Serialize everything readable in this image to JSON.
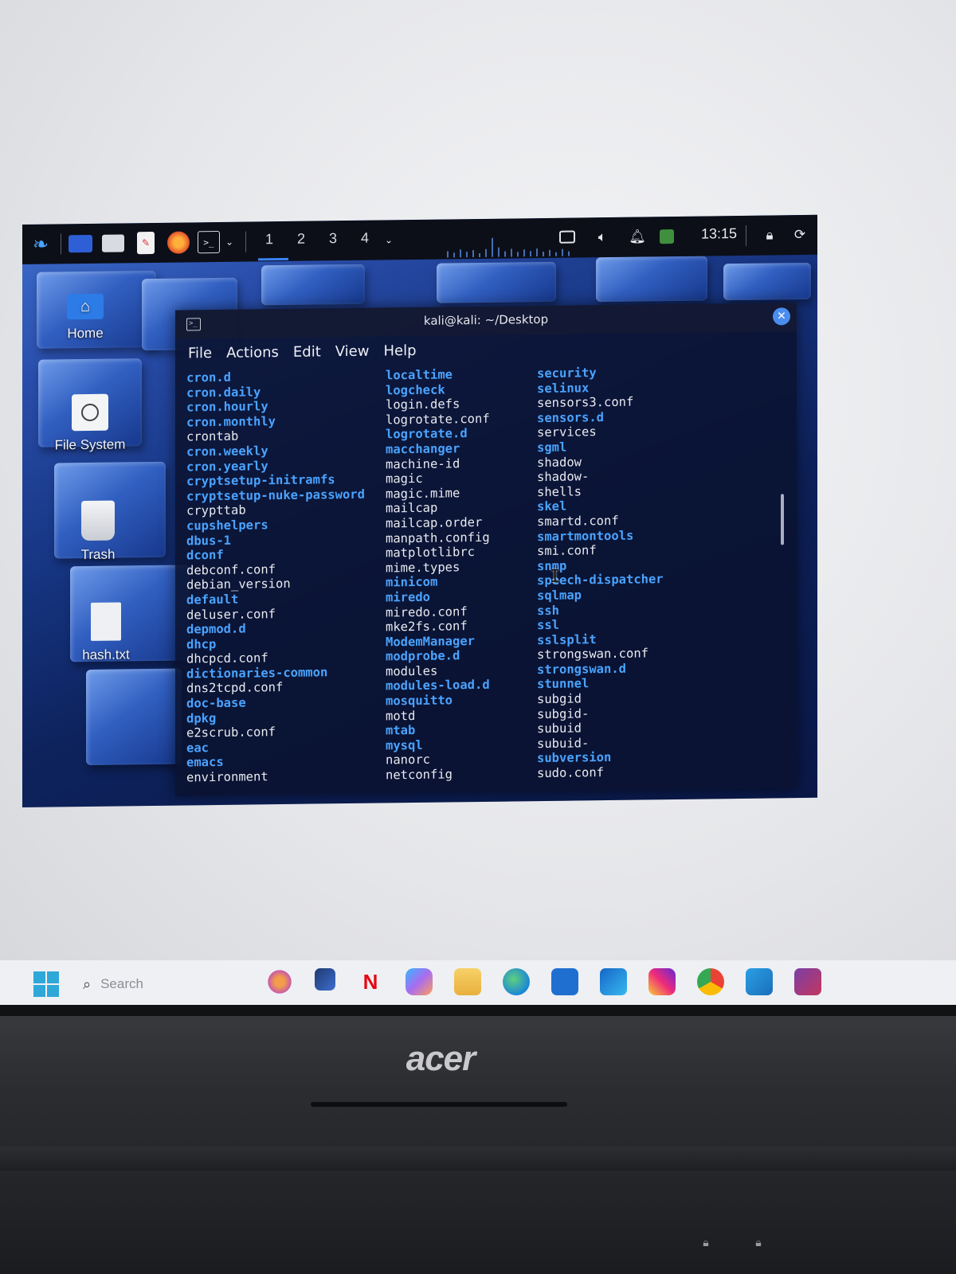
{
  "kali_panel": {
    "workspaces": [
      "1",
      "2",
      "3",
      "4"
    ],
    "clock": "13:15",
    "icons": [
      "kali-menu-icon",
      "desktop-icon",
      "file-manager-icon",
      "text-editor-icon",
      "firefox-icon",
      "terminal-icon",
      "chevron-down-icon",
      "display-icon",
      "volume-icon",
      "bell-icon",
      "battery-icon",
      "lock-icon",
      "power-icon"
    ]
  },
  "desktop_icons": [
    {
      "label": "Home",
      "icon": "home-icon"
    },
    {
      "label": "File System",
      "icon": "drive-icon"
    },
    {
      "label": "Trash",
      "icon": "trash-icon"
    },
    {
      "label": "hash.txt",
      "icon": "text-file-icon"
    }
  ],
  "terminal": {
    "title": "kali@kali: ~/Desktop",
    "menu": [
      "File",
      "Actions",
      "Edit",
      "View",
      "Help"
    ],
    "columns": [
      [
        {
          "name": "cron.d",
          "dir": true
        },
        {
          "name": "cron.daily",
          "dir": true
        },
        {
          "name": "cron.hourly",
          "dir": true
        },
        {
          "name": "cron.monthly",
          "dir": true
        },
        {
          "name": "crontab",
          "dir": false
        },
        {
          "name": "cron.weekly",
          "dir": true
        },
        {
          "name": "cron.yearly",
          "dir": true
        },
        {
          "name": "cryptsetup-initramfs",
          "dir": true
        },
        {
          "name": "cryptsetup-nuke-password",
          "dir": true
        },
        {
          "name": "crypttab",
          "dir": false
        },
        {
          "name": "cupshelpers",
          "dir": true
        },
        {
          "name": "dbus-1",
          "dir": true
        },
        {
          "name": "dconf",
          "dir": true
        },
        {
          "name": "debconf.conf",
          "dir": false
        },
        {
          "name": "debian_version",
          "dir": false
        },
        {
          "name": "default",
          "dir": true
        },
        {
          "name": "deluser.conf",
          "dir": false
        },
        {
          "name": "depmod.d",
          "dir": true
        },
        {
          "name": "dhcp",
          "dir": true
        },
        {
          "name": "dhcpcd.conf",
          "dir": false
        },
        {
          "name": "dictionaries-common",
          "dir": true
        },
        {
          "name": "dns2tcpd.conf",
          "dir": false
        },
        {
          "name": "doc-base",
          "dir": true
        },
        {
          "name": "dpkg",
          "dir": true
        },
        {
          "name": "e2scrub.conf",
          "dir": false
        },
        {
          "name": "eac",
          "dir": true
        },
        {
          "name": "emacs",
          "dir": true
        },
        {
          "name": "environment",
          "dir": false
        }
      ],
      [
        {
          "name": "localtime",
          "dir": true
        },
        {
          "name": "logcheck",
          "dir": true
        },
        {
          "name": "login.defs",
          "dir": false
        },
        {
          "name": "logrotate.conf",
          "dir": false
        },
        {
          "name": "logrotate.d",
          "dir": true
        },
        {
          "name": "macchanger",
          "dir": true
        },
        {
          "name": "machine-id",
          "dir": false
        },
        {
          "name": "magic",
          "dir": false
        },
        {
          "name": "magic.mime",
          "dir": false
        },
        {
          "name": "mailcap",
          "dir": false
        },
        {
          "name": "mailcap.order",
          "dir": false
        },
        {
          "name": "manpath.config",
          "dir": false
        },
        {
          "name": "matplotlibrc",
          "dir": false
        },
        {
          "name": "mime.types",
          "dir": false
        },
        {
          "name": "minicom",
          "dir": true
        },
        {
          "name": "miredo",
          "dir": true
        },
        {
          "name": "miredo.conf",
          "dir": false
        },
        {
          "name": "mke2fs.conf",
          "dir": false
        },
        {
          "name": "ModemManager",
          "dir": true
        },
        {
          "name": "modprobe.d",
          "dir": true
        },
        {
          "name": "modules",
          "dir": false
        },
        {
          "name": "modules-load.d",
          "dir": true
        },
        {
          "name": "mosquitto",
          "dir": true
        },
        {
          "name": "motd",
          "dir": false
        },
        {
          "name": "mtab",
          "dir": true
        },
        {
          "name": "mysql",
          "dir": true
        },
        {
          "name": "nanorc",
          "dir": false
        },
        {
          "name": "netconfig",
          "dir": false
        }
      ],
      [
        {
          "name": "security",
          "dir": true
        },
        {
          "name": "selinux",
          "dir": true
        },
        {
          "name": "sensors3.conf",
          "dir": false
        },
        {
          "name": "sensors.d",
          "dir": true
        },
        {
          "name": "services",
          "dir": false
        },
        {
          "name": "sgml",
          "dir": true
        },
        {
          "name": "shadow",
          "dir": false
        },
        {
          "name": "shadow-",
          "dir": false
        },
        {
          "name": "shells",
          "dir": false
        },
        {
          "name": "skel",
          "dir": true
        },
        {
          "name": "smartd.conf",
          "dir": false
        },
        {
          "name": "smartmontools",
          "dir": true
        },
        {
          "name": "smi.conf",
          "dir": false
        },
        {
          "name": "snmp",
          "dir": true
        },
        {
          "name": "speech-dispatcher",
          "dir": true
        },
        {
          "name": "sqlmap",
          "dir": true
        },
        {
          "name": "ssh",
          "dir": true
        },
        {
          "name": "ssl",
          "dir": true
        },
        {
          "name": "sslsplit",
          "dir": true
        },
        {
          "name": "strongswan.conf",
          "dir": false
        },
        {
          "name": "strongswan.d",
          "dir": true
        },
        {
          "name": "stunnel",
          "dir": true
        },
        {
          "name": "subgid",
          "dir": false
        },
        {
          "name": "subgid-",
          "dir": false
        },
        {
          "name": "subuid",
          "dir": false
        },
        {
          "name": "subuid-",
          "dir": false
        },
        {
          "name": "subversion",
          "dir": true
        },
        {
          "name": "sudo.conf",
          "dir": false
        }
      ]
    ],
    "colors": {
      "directory": "#4aa3ff",
      "file": "#e9ebf0"
    }
  },
  "windows_taskbar": {
    "search_placeholder": "Search",
    "apps": [
      "copilot-flower-icon",
      "files-icon",
      "netflix-icon",
      "copilot-icon",
      "folder-icon",
      "edge-icon",
      "store-icon",
      "outlook-icon",
      "instagram-icon",
      "chrome-icon",
      "vscode-icon",
      "virtualbox-icon"
    ],
    "netflix_label": "N"
  },
  "laptop": {
    "brand": "acer"
  }
}
